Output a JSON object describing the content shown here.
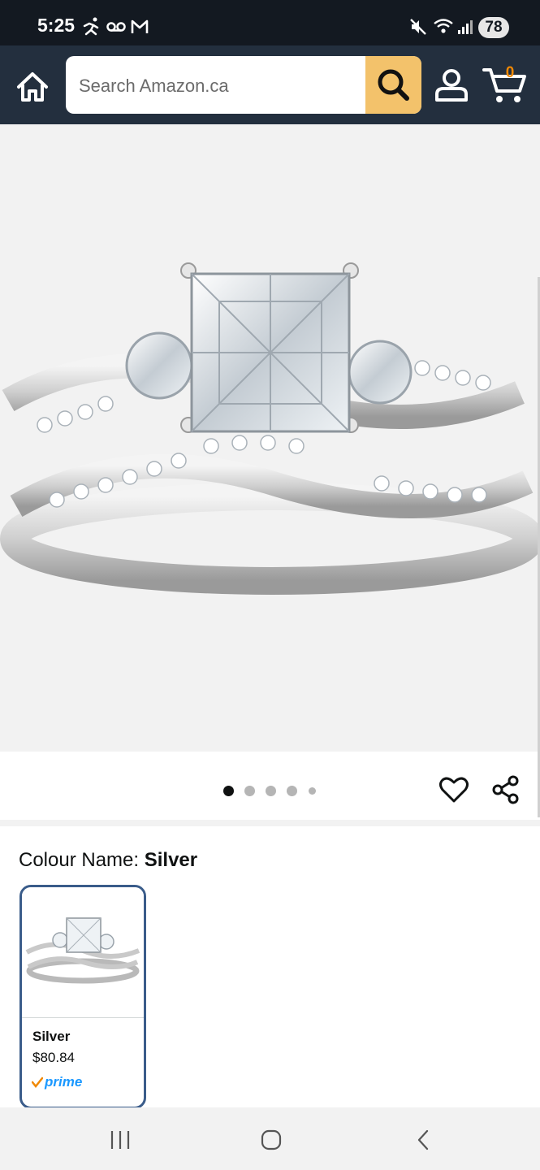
{
  "status_bar": {
    "time": "5:25",
    "battery": "78"
  },
  "header": {
    "search_placeholder": "Search Amazon.ca",
    "cart_count": "0"
  },
  "colours": {
    "accent_header": "#232f3e",
    "search_button": "#f3c26b",
    "cart_badge": "#f08804",
    "swatch_border": "#3a5c8a"
  },
  "carousel": {
    "total_images": 5,
    "active_index": 0
  },
  "variation": {
    "label_prefix": "Colour Name: ",
    "selected_value": "Silver",
    "options": [
      {
        "name": "Silver",
        "price": "$80.84",
        "prime": "prime"
      }
    ]
  }
}
